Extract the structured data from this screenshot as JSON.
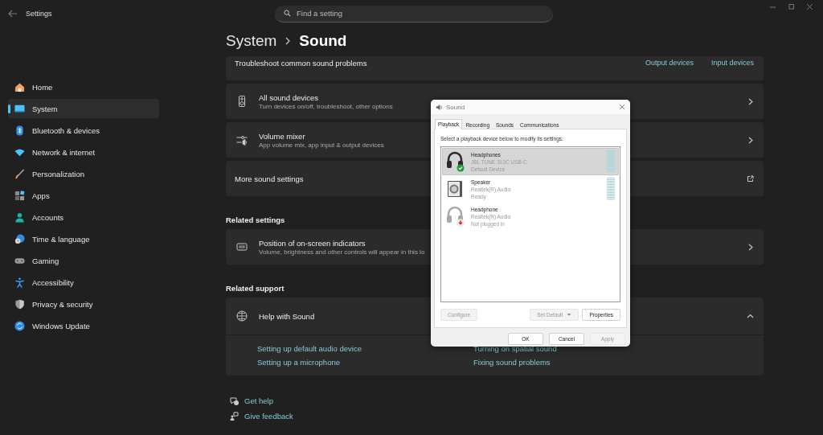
{
  "window": {
    "title": "Settings"
  },
  "search": {
    "placeholder": "Find a setting"
  },
  "breadcrumb": [
    "System",
    "Sound"
  ],
  "sidebar": {
    "items": [
      {
        "label": "Home",
        "selected": false
      },
      {
        "label": "System",
        "selected": true
      },
      {
        "label": "Bluetooth & devices",
        "selected": false
      },
      {
        "label": "Network & internet",
        "selected": false
      },
      {
        "label": "Personalization",
        "selected": false
      },
      {
        "label": "Apps",
        "selected": false
      },
      {
        "label": "Accounts",
        "selected": false
      },
      {
        "label": "Time & language",
        "selected": false
      },
      {
        "label": "Gaming",
        "selected": false
      },
      {
        "label": "Accessibility",
        "selected": false
      },
      {
        "label": "Privacy & security",
        "selected": false
      },
      {
        "label": "Windows Update",
        "selected": false
      }
    ]
  },
  "troubleshoot": {
    "label": "Troubleshoot common sound problems",
    "links": [
      "Output devices",
      "Input devices"
    ]
  },
  "settings": [
    {
      "title": "All sound devices",
      "subtitle": "Turn devices on/off, troubleshoot, other options",
      "kind": "navigate"
    },
    {
      "title": "Volume mixer",
      "subtitle": "App volume mix, app input & output devices",
      "kind": "navigate"
    },
    {
      "title": "More sound settings",
      "kind": "external"
    }
  ],
  "related_settings": {
    "heading": "Related settings",
    "items": [
      {
        "title": "Position of on-screen indicators",
        "subtitle": "Volume, brightness and other controls will appear in this lo",
        "kind": "navigate"
      }
    ]
  },
  "related_support": {
    "heading": "Related support",
    "title": "Help with Sound",
    "expanded": true,
    "links": [
      "Setting up default audio device",
      "Turning on spatial sound",
      "Setting up a microphone",
      "Fixing sound problems"
    ]
  },
  "footer_links": [
    "Get help",
    "Give feedback"
  ],
  "dialog": {
    "title": "Sound",
    "tabs": [
      {
        "label": "Playback",
        "selected": true
      },
      {
        "label": "Recording",
        "selected": false
      },
      {
        "label": "Sounds",
        "selected": false
      },
      {
        "label": "Communications",
        "selected": false
      }
    ],
    "instruction": "Select a playback device below to modify its settings:",
    "devices": [
      {
        "name": "Headphones",
        "detail": "JBL TUNE 310C USB-C",
        "status": "Default Device",
        "kind": "headphones-default",
        "selected": true,
        "meter": true
      },
      {
        "name": "Speaker",
        "detail": "Realtek(R) Audio",
        "status": "Ready",
        "kind": "speaker",
        "selected": false,
        "meter": true
      },
      {
        "name": "Headphone",
        "detail": "Realtek(R) Audio",
        "status": "Not plugged in",
        "kind": "headphones-unplugged",
        "selected": false,
        "meter": false
      }
    ],
    "buttons": [
      {
        "label": "Configure",
        "disabled": true,
        "kind": "plain"
      },
      {
        "label": "Set Default",
        "disabled": true,
        "kind": "split"
      },
      {
        "label": "Properties",
        "disabled": false,
        "kind": "plain"
      }
    ],
    "footer_buttons": [
      {
        "label": "OK",
        "disabled": false
      },
      {
        "label": "Cancel",
        "disabled": false
      },
      {
        "label": "Apply",
        "disabled": true
      }
    ]
  }
}
